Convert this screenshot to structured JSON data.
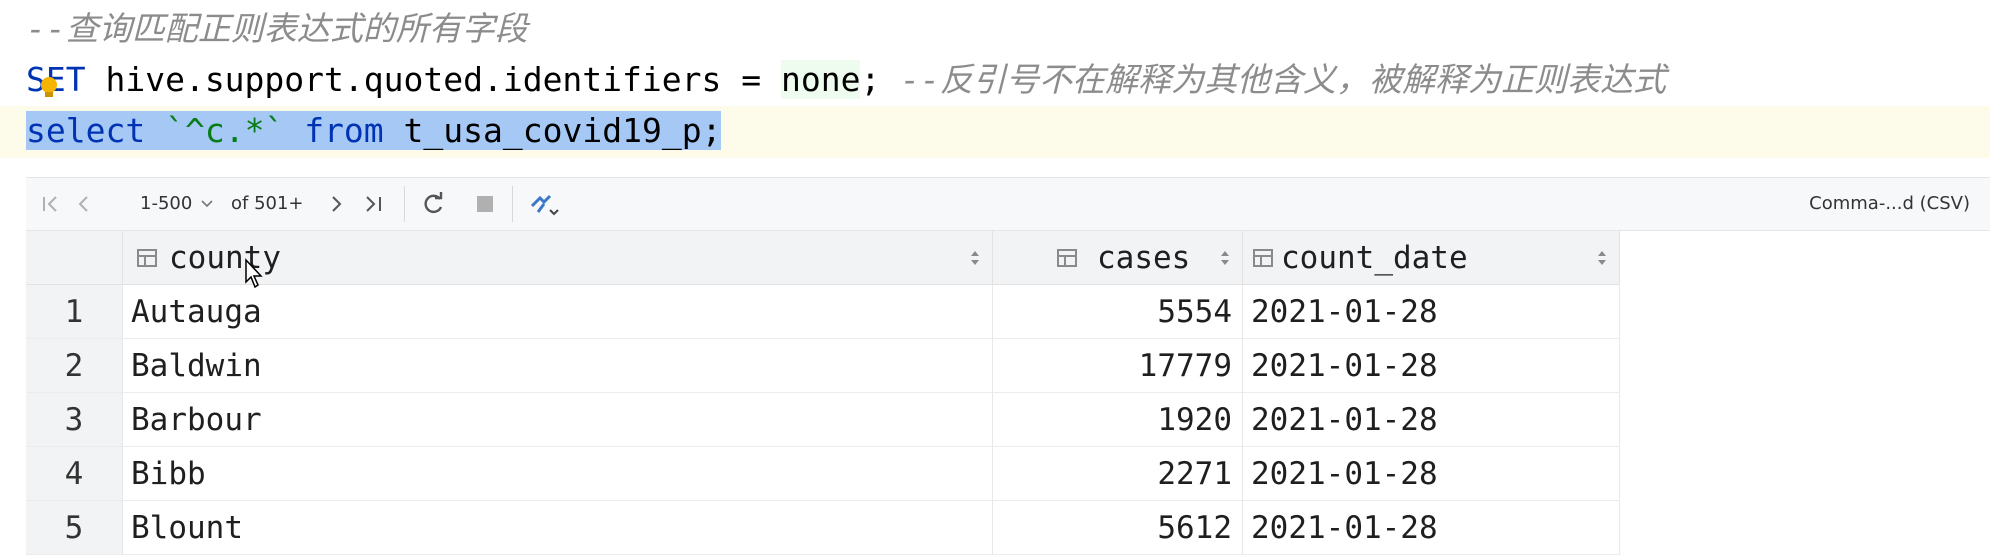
{
  "editor": {
    "comment_line": "--查询匹配正则表达式的所有字段",
    "set_line": {
      "keyword": "SET",
      "property": " hive.support.quoted.identifiers = ",
      "value": "none",
      "terminator": ";",
      "comment": " --反引号不在解释为其他含义，被解释为正则表达式"
    },
    "select_line": {
      "kw_select": "select",
      "pattern": "`^c.*`",
      "kw_from": "from",
      "table": "t_usa_covid19_p",
      "terminator": ";"
    }
  },
  "toolbar": {
    "range": "1-500",
    "of_total": "of 501+",
    "export_format": "Comma-...d (CSV)"
  },
  "table": {
    "columns": [
      "county",
      "cases",
      "count_date"
    ],
    "rows": [
      {
        "n": "1",
        "county": "Autauga",
        "cases": "5554",
        "count_date": "2021-01-28"
      },
      {
        "n": "2",
        "county": "Baldwin",
        "cases": "17779",
        "count_date": "2021-01-28"
      },
      {
        "n": "3",
        "county": "Barbour",
        "cases": "1920",
        "count_date": "2021-01-28"
      },
      {
        "n": "4",
        "county": "Bibb",
        "cases": "2271",
        "count_date": "2021-01-28"
      },
      {
        "n": "5",
        "county": "Blount",
        "cases": "5612",
        "count_date": "2021-01-28"
      }
    ]
  },
  "icons": {
    "first_page": "first-page-icon",
    "prev_page": "prev-page-icon",
    "next_page": "next-page-icon",
    "last_page": "last-page-icon",
    "refresh": "refresh-icon",
    "stop": "stop-icon",
    "pin": "pin-icon",
    "bulb": "intention-bulb-icon"
  },
  "colors": {
    "keyword": "#0033b3",
    "comment": "#8c8c8c",
    "selection": "#a6c8f5"
  }
}
